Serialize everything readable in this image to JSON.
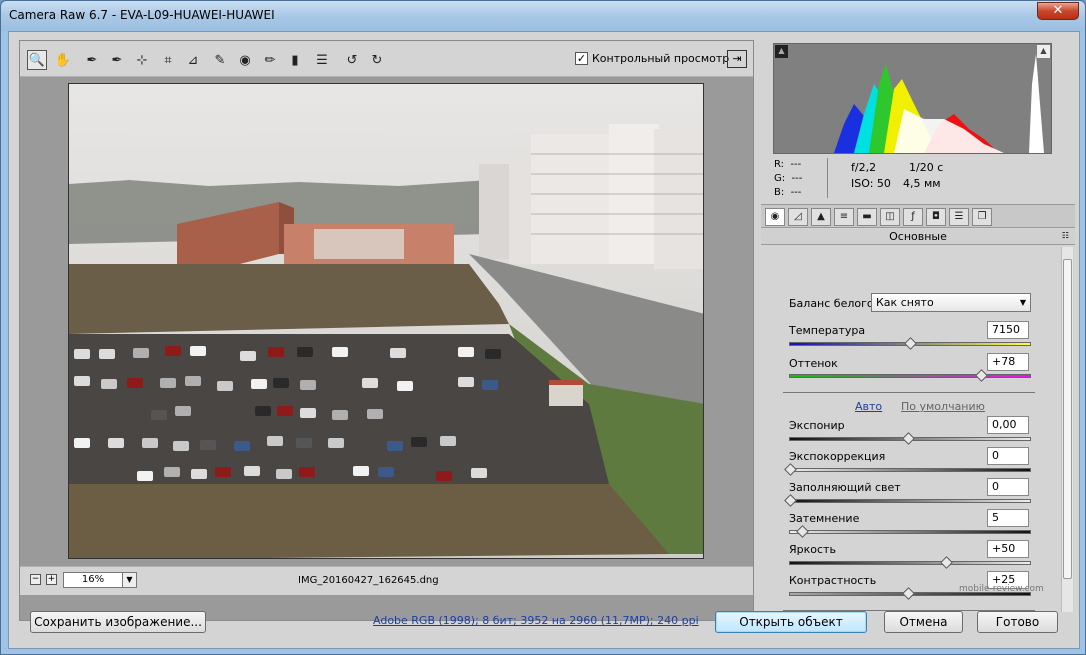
{
  "window": {
    "title": "Camera Raw 6.7  -  EVA-L09-HUAWEI-HUAWEI",
    "close_glyph": "✕"
  },
  "toolbar": {
    "tools": [
      {
        "name": "zoom-tool-icon",
        "glyph": "🔍"
      },
      {
        "name": "hand-tool-icon",
        "glyph": "✋"
      },
      {
        "name": "white-balance-tool-icon",
        "glyph": "✒"
      },
      {
        "name": "color-sampler-tool-icon",
        "glyph": "✒"
      },
      {
        "name": "targeted-adjustment-tool-icon",
        "glyph": "⊹"
      },
      {
        "name": "crop-tool-icon",
        "glyph": "⌗"
      },
      {
        "name": "straighten-tool-icon",
        "glyph": "⊿"
      },
      {
        "name": "spot-removal-tool-icon",
        "glyph": "✎"
      },
      {
        "name": "red-eye-tool-icon",
        "glyph": "◉"
      },
      {
        "name": "adjustment-brush-icon",
        "glyph": "✏"
      },
      {
        "name": "graduated-filter-icon",
        "glyph": "▮"
      },
      {
        "name": "preferences-icon",
        "glyph": "☰"
      },
      {
        "name": "rotate-left-icon",
        "glyph": "↺"
      },
      {
        "name": "rotate-right-icon",
        "glyph": "↻"
      }
    ],
    "preview_label": "Контрольный просмотр",
    "preview_checked": "✓"
  },
  "status": {
    "zoom": "16%",
    "filename": "IMG_20160427_162645.dng"
  },
  "histogram": {
    "r_label": "R:",
    "r_val": "---",
    "g_label": "G:",
    "g_val": "---",
    "b_label": "B:",
    "b_val": "---",
    "aperture": "f/2,2",
    "shutter": "1/20 с",
    "iso": "ISO: 50",
    "focal": "4,5 мм"
  },
  "panel": {
    "title": "Основные",
    "wb_label": "Баланс белого:",
    "wb_value": "Как снято",
    "temperature_label": "Температура",
    "temperature_value": "7150",
    "tint_label": "Оттенок",
    "tint_value": "+78",
    "auto_link": "Авто",
    "default_link": "По умолчанию",
    "exposure_label": "Экспонир",
    "exposure_value": "0,00",
    "recovery_label": "Экспокоррекция",
    "recovery_value": "0",
    "fill_label": "Заполняющий свет",
    "fill_value": "0",
    "blacks_label": "Затемнение",
    "blacks_value": "5",
    "brightness_label": "Яркость",
    "brightness_value": "+50",
    "contrast_label": "Контрастность",
    "contrast_value": "+25"
  },
  "slider_levels": {
    "temperature": 0.51,
    "tint": 0.81,
    "exposure": 0.5,
    "recovery": 0.0,
    "fill": 0.0,
    "blacks": 0.05,
    "brightness": 0.66,
    "contrast": 0.5
  },
  "bottom": {
    "save_label": "Сохранить изображение...",
    "workflow_link": "Adobe RGB (1998); 8 бит; 3952 на 2960 (11,7MP); 240 ppi",
    "open_label": "Открыть объект",
    "cancel_label": "Отмена",
    "done_label": "Готово"
  },
  "watermark": "mobile-review.com"
}
